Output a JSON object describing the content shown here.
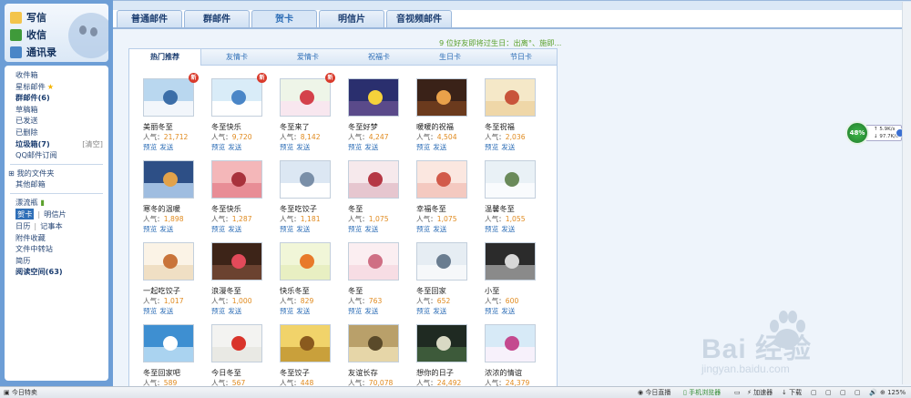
{
  "sidebar": {
    "compose": "写信",
    "receive": "收信",
    "contacts": "通讯录",
    "folders": [
      {
        "label": "收件箱",
        "bold": false
      },
      {
        "label": "星标邮件",
        "bold": false,
        "star": true
      },
      {
        "label": "群邮件(6)",
        "bold": true
      },
      {
        "label": "草稿箱",
        "bold": false
      },
      {
        "label": "已发送",
        "bold": false
      },
      {
        "label": "已删除",
        "bold": false
      },
      {
        "label": "垃圾箱(7)",
        "bold": true,
        "clear": "[清空]"
      },
      {
        "label": "QQ邮件订阅",
        "bold": false
      }
    ],
    "my_folders": "我的文件夹",
    "other_mail": "其他邮箱",
    "drift_bottle": "漂流瓶",
    "tools_1": {
      "a": "贺卡",
      "b": "明信片"
    },
    "tools_2": {
      "a": "日历",
      "b": "记事本"
    },
    "attachments": "附件收藏",
    "file_transfer": "文件中转站",
    "resume": "简历",
    "reading": "阅读空间(63)"
  },
  "tabs": [
    "普通邮件",
    "群邮件",
    "贺卡",
    "明信片",
    "音视频邮件"
  ],
  "active_tab": 2,
  "birthday_notice": "9 位好友即将过生日：出离°、施即...",
  "subtabs": [
    "热门推荐",
    "友情卡",
    "爱情卡",
    "祝福卡",
    "生日卡",
    "节日卡"
  ],
  "labels": {
    "preview": "预览",
    "send": "发送",
    "pop": "人气："
  },
  "cards": [
    {
      "title": "美丽冬至",
      "pop": "21,712",
      "new": true,
      "c1": "#b9d7ef",
      "c2": "#f2f6fb",
      "c3": "#3b6ea8"
    },
    {
      "title": "冬至快乐",
      "pop": "9,720",
      "new": true,
      "c1": "#d9ecf8",
      "c2": "#ffffff",
      "c3": "#4a86c7"
    },
    {
      "title": "冬至来了",
      "pop": "8,142",
      "new": true,
      "c1": "#eef5e8",
      "c2": "#f8e7ef",
      "c3": "#d4414b"
    },
    {
      "title": "冬至好梦",
      "pop": "4,247",
      "new": false,
      "c1": "#2a2f6e",
      "c2": "#5a4a8a",
      "c3": "#f5d23b"
    },
    {
      "title": "暖暖的祝福",
      "pop": "4,504",
      "new": false,
      "c1": "#3a2218",
      "c2": "#6b3a1d",
      "c3": "#e9a14a"
    },
    {
      "title": "冬至祝福",
      "pop": "2,036",
      "new": false,
      "c1": "#f5e8c8",
      "c2": "#efd7a8",
      "c3": "#c8543b"
    },
    {
      "title": "寒冬的温暖",
      "pop": "1,898",
      "new": false,
      "c1": "#2d4f86",
      "c2": "#9fbde0",
      "c3": "#e2a24a"
    },
    {
      "title": "冬至快乐",
      "pop": "1,287",
      "new": false,
      "c1": "#f4b7b9",
      "c2": "#e88d96",
      "c3": "#a8323c"
    },
    {
      "title": "冬至吃饺子",
      "pop": "1,181",
      "new": false,
      "c1": "#dce7f3",
      "c2": "#ffffff",
      "c3": "#7a8fa8"
    },
    {
      "title": "冬至",
      "pop": "1,075",
      "new": false,
      "c1": "#f6e9ec",
      "c2": "#e6c6cf",
      "c3": "#b53845"
    },
    {
      "title": "幸福冬至",
      "pop": "1,075",
      "new": false,
      "c1": "#fbe7e0",
      "c2": "#f4c9c0",
      "c3": "#d25a4a"
    },
    {
      "title": "温馨冬至",
      "pop": "1,055",
      "new": false,
      "c1": "#e9f1f6",
      "c2": "#f9fbfd",
      "c3": "#6a8a5a"
    },
    {
      "title": "一起吃饺子",
      "pop": "1,017",
      "new": false,
      "c1": "#fbf3e6",
      "c2": "#f0dfc4",
      "c3": "#c9743a"
    },
    {
      "title": "浪漫冬至",
      "pop": "1,000",
      "new": false,
      "c1": "#3d2418",
      "c2": "#6b4230",
      "c3": "#e24a5a"
    },
    {
      "title": "快乐冬至",
      "pop": "829",
      "new": false,
      "c1": "#f1f6d8",
      "c2": "#e8efc2",
      "c3": "#e87a2a"
    },
    {
      "title": "冬至",
      "pop": "763",
      "new": false,
      "c1": "#fbeef1",
      "c2": "#f7dde4",
      "c3": "#cf6f84"
    },
    {
      "title": "冬至回家",
      "pop": "652",
      "new": false,
      "c1": "#e6edf3",
      "c2": "#f6f8fa",
      "c3": "#6a7d90"
    },
    {
      "title": "小至",
      "pop": "600",
      "new": false,
      "c1": "#2b2b2b",
      "c2": "#8a8a8a",
      "c3": "#d8d8d8"
    },
    {
      "title": "冬至回家吧",
      "pop": "589",
      "new": false,
      "c1": "#3e8fd1",
      "c2": "#aad3f0",
      "c3": "#ffffff"
    },
    {
      "title": "今日冬至",
      "pop": "567",
      "new": false,
      "c1": "#f3f3f1",
      "c2": "#e9e9e4",
      "c3": "#d9342b"
    },
    {
      "title": "冬至饺子",
      "pop": "448",
      "new": false,
      "c1": "#f1d36a",
      "c2": "#c9a03b",
      "c3": "#8a5a1e"
    },
    {
      "title": "友谊长存",
      "pop": "70,078",
      "new": false,
      "c1": "#b9a06a",
      "c2": "#e6d6a8",
      "c3": "#5a4a2a"
    },
    {
      "title": "想你的日子",
      "pop": "24,492",
      "new": false,
      "c1": "#1f2a22",
      "c2": "#3d5a3a",
      "c3": "#d9d9c4"
    },
    {
      "title": "浓浓的情谊",
      "pop": "24,379",
      "new": false,
      "c1": "#d7eaf7",
      "c2": "#f7f1fb",
      "c3": "#c44a8f"
    }
  ],
  "float_widget": {
    "percent": "48%",
    "up": "5.9K/s",
    "down": "97.7K/s"
  },
  "watermark": {
    "main": "Bai 经验",
    "sub": "jingyan.baidu.com"
  },
  "statusbar": {
    "left": "今日特卖",
    "items": [
      "今日直播",
      "手机浏览器",
      "加速器",
      "下载",
      "125%"
    ]
  }
}
